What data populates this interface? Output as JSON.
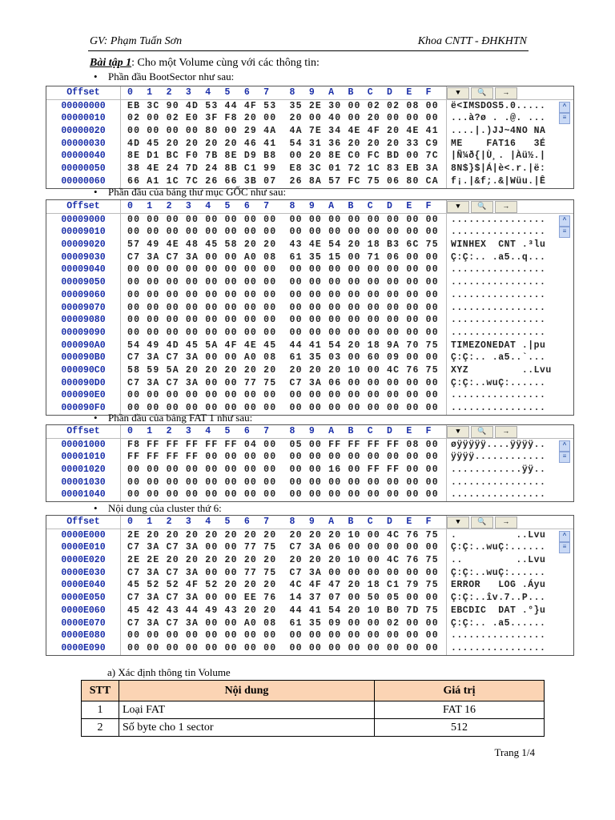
{
  "header": {
    "left": "GV: Phạm Tuấn Sơn",
    "right": "Khoa CNTT - ĐHKHTN"
  },
  "intro": {
    "label": "Bài tập 1",
    "text": ": Cho một Volume cùng với các thông tin:"
  },
  "hex_header": {
    "offset": "Offset",
    "cols": "0  1  2  3  4  5  6  7   8  9  A  B  C  D  E  F"
  },
  "toolbar_icons": [
    "dropdown-icon",
    "search-icon",
    "arrow-icon"
  ],
  "sections": [
    {
      "caption": "Phần đầu BootSector như sau:",
      "rows": [
        {
          "offset": "00000000",
          "hex": "EB 3C 90 4D 53 44 4F 53  35 2E 30 00 02 02 08 00",
          "ascii": "ë<IMSDOS5.0....."
        },
        {
          "offset": "00000010",
          "hex": "02 00 02 E0 3F F8 20 00  20 00 40 00 20 00 00 00",
          "ascii": "...à?ø . .@. ..."
        },
        {
          "offset": "00000020",
          "hex": "00 00 00 00 80 00 29 4A  4A 7E 34 4E 4F 20 4E 41",
          "ascii": "....|.)JJ~4NO NA"
        },
        {
          "offset": "00000030",
          "hex": "4D 45 20 20 20 20 46 41  54 31 36 20 20 20 33 C9",
          "ascii": "ME    FAT16   3É"
        },
        {
          "offset": "00000040",
          "hex": "8E D1 BC F0 7B 8E D9 B8  00 20 8E C0 FC BD 00 7C",
          "ascii": "|Ñ¼ð{|Ù¸. |Àü½.|"
        },
        {
          "offset": "00000050",
          "hex": "38 4E 24 7D 24 8B C1 99  E8 3C 01 72 1C 83 EB 3A",
          "ascii": "8N$}$|Á|è<.r.|ë:"
        },
        {
          "offset": "00000060",
          "hex": "66 A1 1C 7C 26 66 3B 07  26 8A 57 FC 75 06 80 CA",
          "ascii": "f¡.|&f;.&|Wüu.|Ê"
        }
      ]
    },
    {
      "caption": "Phần đầu của bảng thư mục GỐC như sau:",
      "rows": [
        {
          "offset": "00009000",
          "hex": "00 00 00 00 00 00 00 00  00 00 00 00 00 00 00 00",
          "ascii": "................"
        },
        {
          "offset": "00009010",
          "hex": "00 00 00 00 00 00 00 00  00 00 00 00 00 00 00 00",
          "ascii": "................"
        },
        {
          "offset": "00009020",
          "hex": "57 49 4E 48 45 58 20 20  43 4E 54 20 18 B3 6C 75",
          "ascii": "WINHEX  CNT .³lu"
        },
        {
          "offset": "00009030",
          "hex": "C7 3A C7 3A 00 00 A0 08  61 35 15 00 71 06 00 00",
          "ascii": "Ç:Ç:.. .a5..q..."
        },
        {
          "offset": "00009040",
          "hex": "00 00 00 00 00 00 00 00  00 00 00 00 00 00 00 00",
          "ascii": "................"
        },
        {
          "offset": "00009050",
          "hex": "00 00 00 00 00 00 00 00  00 00 00 00 00 00 00 00",
          "ascii": "................"
        },
        {
          "offset": "00009060",
          "hex": "00 00 00 00 00 00 00 00  00 00 00 00 00 00 00 00",
          "ascii": "................"
        },
        {
          "offset": "00009070",
          "hex": "00 00 00 00 00 00 00 00  00 00 00 00 00 00 00 00",
          "ascii": "................"
        },
        {
          "offset": "00009080",
          "hex": "00 00 00 00 00 00 00 00  00 00 00 00 00 00 00 00",
          "ascii": "................"
        },
        {
          "offset": "00009090",
          "hex": "00 00 00 00 00 00 00 00  00 00 00 00 00 00 00 00",
          "ascii": "................"
        },
        {
          "offset": "000090A0",
          "hex": "54 49 4D 45 5A 4F 4E 45  44 41 54 20 18 9A 70 75",
          "ascii": "TIMEZONEDAT .|pu"
        },
        {
          "offset": "000090B0",
          "hex": "C7 3A C7 3A 00 00 A0 08  61 35 03 00 60 09 00 00",
          "ascii": "Ç:Ç:.. .a5..`..."
        },
        {
          "offset": "000090C0",
          "hex": "58 59 5A 20 20 20 20 20  20 20 20 10 00 4C 76 75",
          "ascii": "XYZ         ..Lvu"
        },
        {
          "offset": "000090D0",
          "hex": "C7 3A C7 3A 00 00 77 75  C7 3A 06 00 00 00 00 00",
          "ascii": "Ç:Ç:..wuÇ:......"
        },
        {
          "offset": "000090E0",
          "hex": "00 00 00 00 00 00 00 00  00 00 00 00 00 00 00 00",
          "ascii": "................"
        },
        {
          "offset": "000090F0",
          "hex": "00 00 00 00 00 00 00 00  00 00 00 00 00 00 00 00",
          "ascii": "................"
        }
      ]
    },
    {
      "caption": "Phần đầu của bảng FAT 1 như sau:",
      "rows": [
        {
          "offset": "00001000",
          "hex": "F8 FF FF FF FF FF 04 00  05 00 FF FF FF FF 08 00",
          "ascii": "øÿÿÿÿÿ....ÿÿÿÿ.."
        },
        {
          "offset": "00001010",
          "hex": "FF FF FF FF 00 00 00 00  00 00 00 00 00 00 00 00",
          "ascii": "ÿÿÿÿ............"
        },
        {
          "offset": "00001020",
          "hex": "00 00 00 00 00 00 00 00  00 00 16 00 FF FF 00 00",
          "ascii": "............ÿÿ.."
        },
        {
          "offset": "00001030",
          "hex": "00 00 00 00 00 00 00 00  00 00 00 00 00 00 00 00",
          "ascii": "................"
        },
        {
          "offset": "00001040",
          "hex": "00 00 00 00 00 00 00 00  00 00 00 00 00 00 00 00",
          "ascii": "................"
        }
      ]
    },
    {
      "caption": "Nội dung của cluster thứ 6:",
      "rows": [
        {
          "offset": "0000E000",
          "hex": "2E 20 20 20 20 20 20 20  20 20 20 10 00 4C 76 75",
          "ascii": ".          ..Lvu"
        },
        {
          "offset": "0000E010",
          "hex": "C7 3A C7 3A 00 00 77 75  C7 3A 06 00 00 00 00 00",
          "ascii": "Ç:Ç:..wuÇ:......"
        },
        {
          "offset": "0000E020",
          "hex": "2E 2E 20 20 20 20 20 20  20 20 20 10 00 4C 76 75",
          "ascii": "..         ..Lvu"
        },
        {
          "offset": "0000E030",
          "hex": "C7 3A C7 3A 00 00 77 75  C7 3A 00 00 00 00 00 00",
          "ascii": "Ç:Ç:..wuÇ:......"
        },
        {
          "offset": "0000E040",
          "hex": "45 52 52 4F 52 20 20 20  4C 4F 47 20 18 C1 79 75",
          "ascii": "ERROR   LOG .Áyu"
        },
        {
          "offset": "0000E050",
          "hex": "C7 3A C7 3A 00 00 EE 76  14 37 07 00 50 05 00 00",
          "ascii": "Ç:Ç:..îv.7..P..."
        },
        {
          "offset": "0000E060",
          "hex": "45 42 43 44 49 43 20 20  44 41 54 20 10 B0 7D 75",
          "ascii": "EBCDIC  DAT .°}u"
        },
        {
          "offset": "0000E070",
          "hex": "C7 3A C7 3A 00 00 A0 08  61 35 09 00 00 02 00 00",
          "ascii": "Ç:Ç:.. .a5......"
        },
        {
          "offset": "0000E080",
          "hex": "00 00 00 00 00 00 00 00  00 00 00 00 00 00 00 00",
          "ascii": "................"
        },
        {
          "offset": "0000E090",
          "hex": "00 00 00 00 00 00 00 00  00 00 00 00 00 00 00 00",
          "ascii": "................"
        }
      ]
    }
  ],
  "question_a": "a)   Xác định thông tin Volume",
  "table": {
    "headers": [
      "STT",
      "Nội dung",
      "Giá trị"
    ],
    "rows": [
      [
        "1",
        "Loại FAT",
        "FAT 16"
      ],
      [
        "2",
        "Số byte cho 1 sector",
        "512"
      ]
    ]
  },
  "footer": "Trang 1/4"
}
